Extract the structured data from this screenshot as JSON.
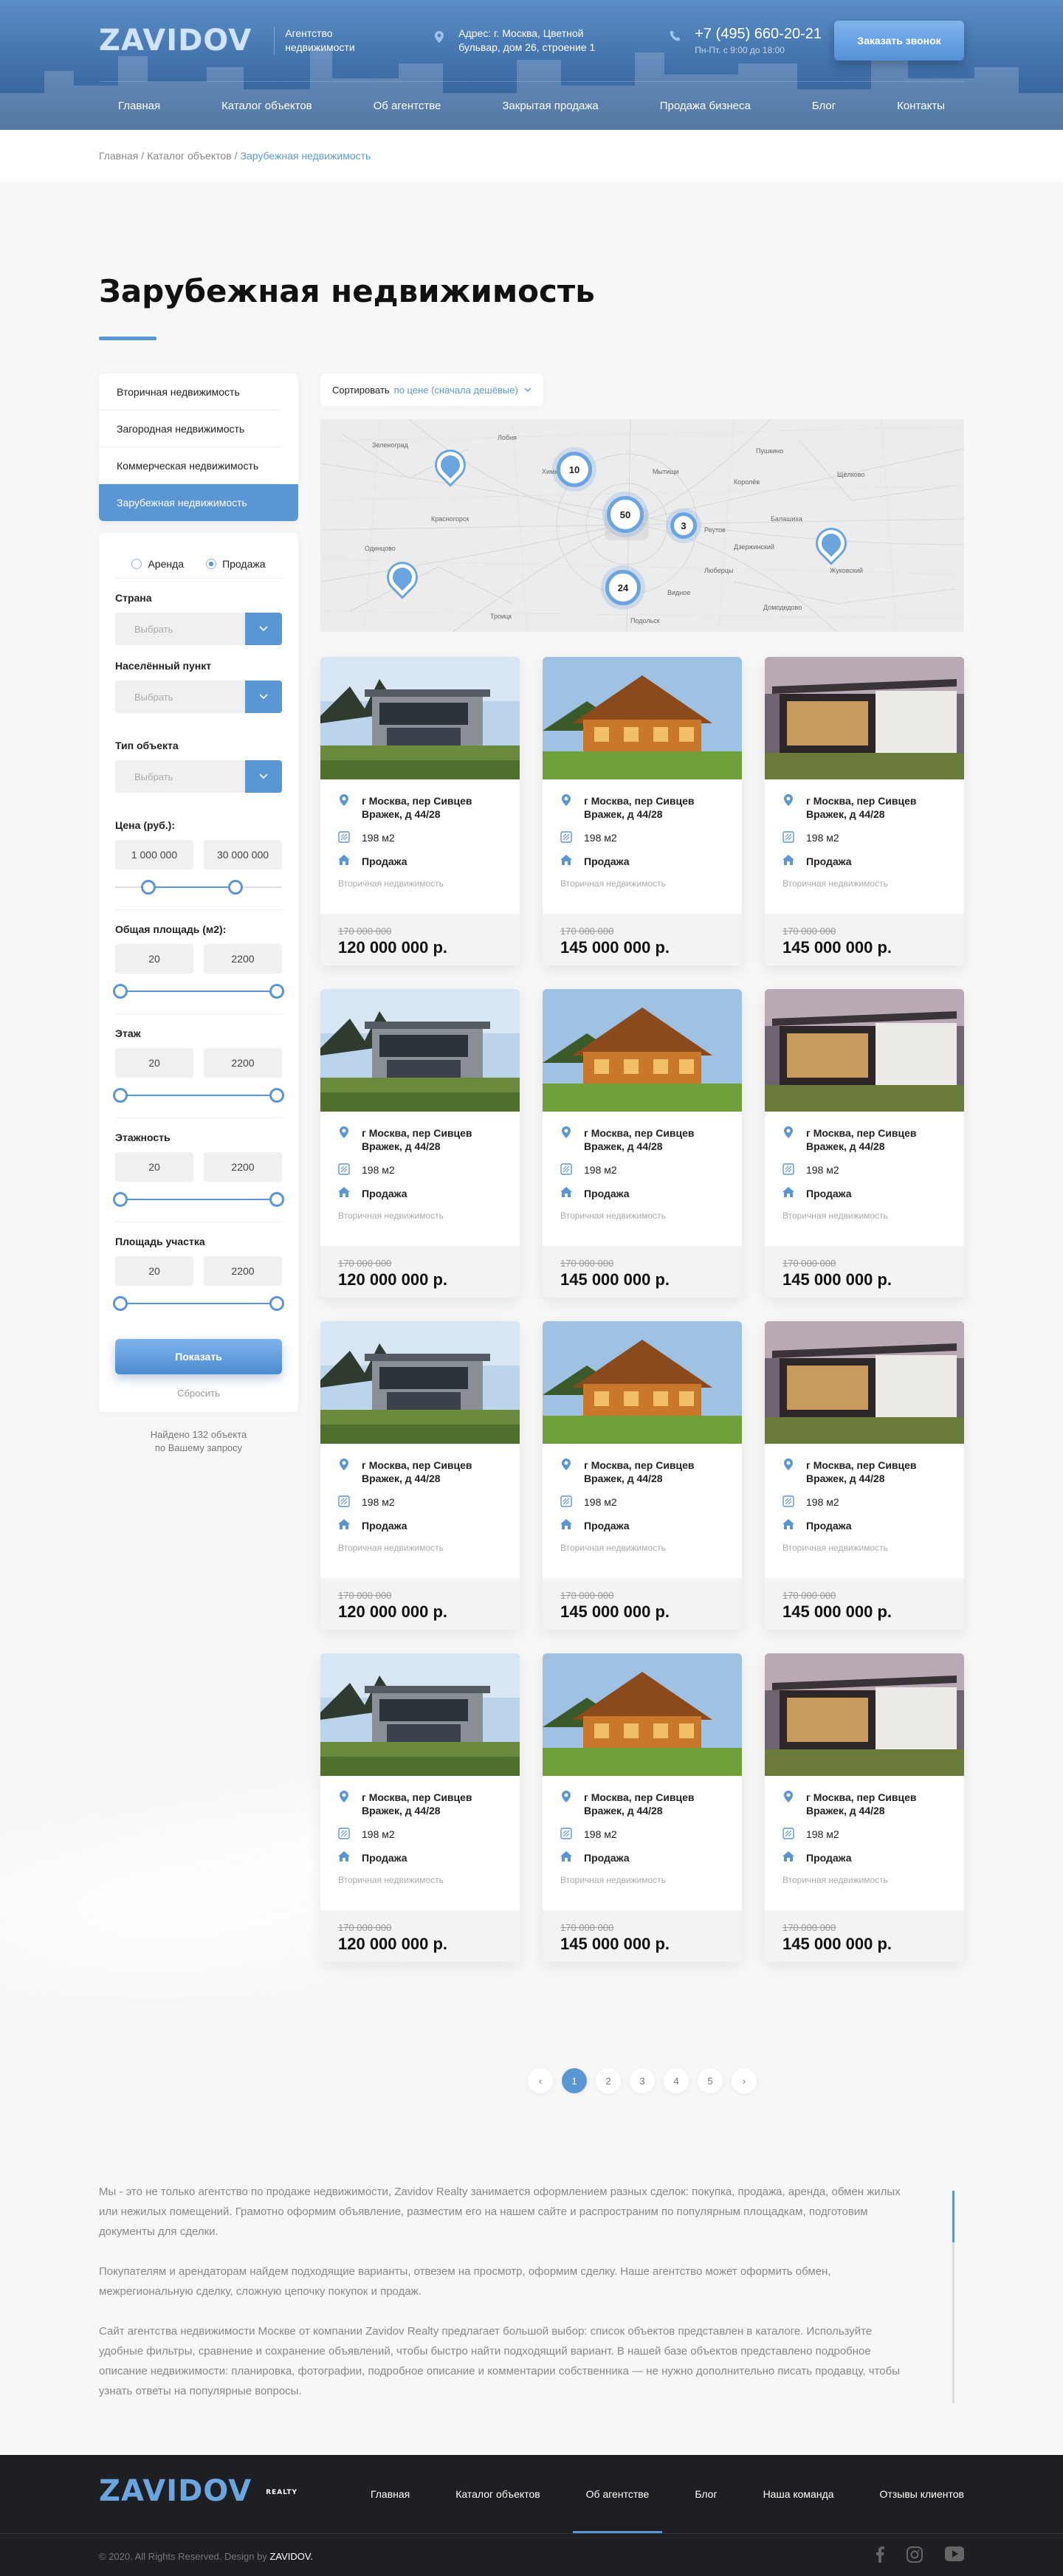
{
  "header": {
    "logo": "ZAVIDOV",
    "tagline": "Агентство недвижимости",
    "address": "Адрес: г. Москва, Цветной бульвар, дом 26, строение 1",
    "phone": "+7 (495) 660-20-21",
    "hours": "Пн-Пт. с 9:00 до 18:00",
    "call_button": "Заказать звонок",
    "nav": [
      "Главная",
      "Каталог объектов",
      "Об агентстве",
      "Закрытая продажа",
      "Продажа бизнеса",
      "Блог",
      "Контакты"
    ]
  },
  "breadcrumb": {
    "items": [
      "Главная",
      "Каталог объектов",
      "Зарубежная недвижимость"
    ]
  },
  "page_title": "Зарубежная недвижимость",
  "categories": [
    "Вторичная недвижимость",
    "Загородная недвижимость",
    "Коммерческая недвижимость",
    "Зарубежная недвижимость"
  ],
  "active_category": "Зарубежная недвижимость",
  "filter": {
    "deal": [
      "Аренда",
      "Продажа"
    ],
    "deal_selected": "Продажа",
    "country_label": "Страна",
    "city_label": "Населённый пункт",
    "type_label": "Тип объекта",
    "select_placeholder": "Выбрать",
    "price": {
      "label": "Цена (руб.):",
      "min": "1 000 000",
      "max": "30 000 000",
      "low": 0.2,
      "high": 0.72
    },
    "area": {
      "label": "Общая площадь (м2):",
      "min": "20",
      "max": "2200",
      "low": 0.03,
      "high": 0.97
    },
    "floor": {
      "label": "Этаж",
      "min": "20",
      "max": "2200",
      "low": 0.03,
      "high": 0.97
    },
    "floors": {
      "label": "Этажность",
      "min": "20",
      "max": "2200",
      "low": 0.03,
      "high": 0.97
    },
    "plot": {
      "label": "Площадь участка",
      "min": "20",
      "max": "2200",
      "low": 0.03,
      "high": 0.97
    },
    "show_button": "Показать",
    "reset": "Сбросить",
    "found_line1": "Найдено 132 объекта",
    "found_line2": "по Вашему запросу"
  },
  "sort": {
    "label": "Сортировать",
    "value": "по цене (сначала дешёвые)"
  },
  "map": {
    "clusters": [
      "10",
      "50",
      "3",
      "24"
    ],
    "places": [
      "Зеленоград",
      "Химки",
      "Мытищи",
      "Королёв",
      "Балашиха",
      "Красногорск",
      "Одинцово",
      "Люберцы",
      "Подольск",
      "Троицк",
      "Пушкино",
      "Видное",
      "Домодедово",
      "Жуковский",
      "Щёлково",
      "Лобня",
      "Дзержинский",
      "Реутов"
    ]
  },
  "listing": {
    "address": "г Москва, пер Сивцев Вражек, д 44/28",
    "area": "198 м2",
    "deal": "Продажа",
    "type": "Вторичная недвижимость",
    "old_price": "170 000 000",
    "prices": [
      "120 000 000 р.",
      "145 000 000 р.",
      "145 000 000 р."
    ]
  },
  "pagination": {
    "prev": "‹",
    "pages": [
      "1",
      "2",
      "3",
      "4",
      "5"
    ],
    "next": "›",
    "current": "1"
  },
  "seo": [
    "Мы - это не только агентство по продаже недвижимости, Zavidov Realty занимается оформлением разных сделок: покупка, продажа, аренда, обмен жилых или нежилых помещений. Грамотно оформим объявление, разместим его на нашем сайте и распространим по популярным площадкам, подготовим документы для сделки.",
    "Покупателям и арендаторам найдем подходящие варианты, отвезем на просмотр, оформим сделку. Наше агентство может оформить обмен, межрегиональную сделку, сложную цепочку покупок и продаж.",
    "Сайт агентства недвижимости Москве от компании Zavidov Realty предлагает большой выбор: список объектов представлен в каталоге. Используйте удобные фильтры, сравнение и сохранение объявлений, чтобы быстро найти подходящий вариант. В нашей базе объектов представлено подробное описание недвижимости: планировка, фотографии, подробное описание и комментарии собственника — не нужно дополнительно писать продавцу, чтобы узнать ответы на популярные вопросы."
  ],
  "footer": {
    "logo": "ZAVIDOV",
    "logo_badge": "REALTY",
    "nav": [
      "Главная",
      "Каталог объектов",
      "Об агентстве",
      "Блог",
      "Наша команда",
      "Отзывы клиентов"
    ],
    "active": "Об агентстве",
    "copyright": "© 2020. All Rights Reserved. Design by",
    "designer": "ZAVIDOV."
  },
  "colors": {
    "accent": "#5b96d4",
    "header": "#3f6ea8",
    "footer": "#1d1f22"
  }
}
